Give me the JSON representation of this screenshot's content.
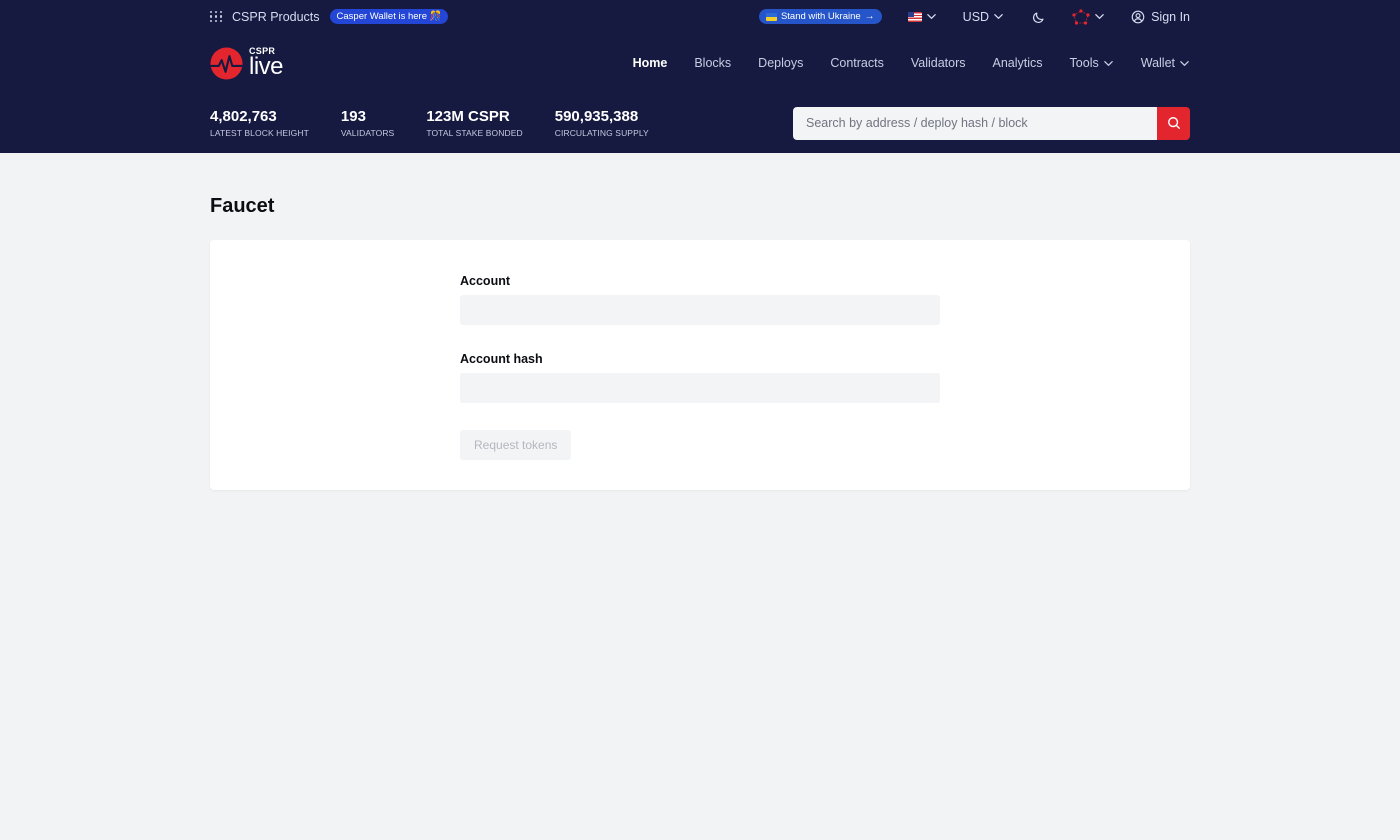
{
  "topbar": {
    "products_label": "CSPR Products",
    "wallet_badge": "Casper Wallet is here 🎊",
    "ukraine_label": "Stand with Ukraine",
    "currency": "USD",
    "signin_label": "Sign In"
  },
  "logo": {
    "small": "CSPR",
    "big": "live"
  },
  "nav": {
    "items": [
      {
        "label": "Home",
        "active": true
      },
      {
        "label": "Blocks"
      },
      {
        "label": "Deploys"
      },
      {
        "label": "Contracts"
      },
      {
        "label": "Validators"
      },
      {
        "label": "Analytics"
      },
      {
        "label": "Tools",
        "dropdown": true
      },
      {
        "label": "Wallet",
        "dropdown": true
      }
    ]
  },
  "stats": [
    {
      "value": "4,802,763",
      "label": "LATEST BLOCK HEIGHT"
    },
    {
      "value": "193",
      "label": "VALIDATORS"
    },
    {
      "value": "123M CSPR",
      "label": "TOTAL STAKE BONDED"
    },
    {
      "value": "590,935,388",
      "label": "CIRCULATING SUPPLY"
    }
  ],
  "search": {
    "placeholder": "Search by address / deploy hash / block",
    "value": ""
  },
  "page": {
    "title": "Faucet"
  },
  "form": {
    "account_label": "Account",
    "account_value": "",
    "account_hash_label": "Account hash",
    "account_hash_value": "",
    "submit_label": "Request tokens"
  },
  "colors": {
    "header_bg": "#161a41",
    "accent_red": "#e3262e",
    "page_bg": "#f2f3f5"
  }
}
